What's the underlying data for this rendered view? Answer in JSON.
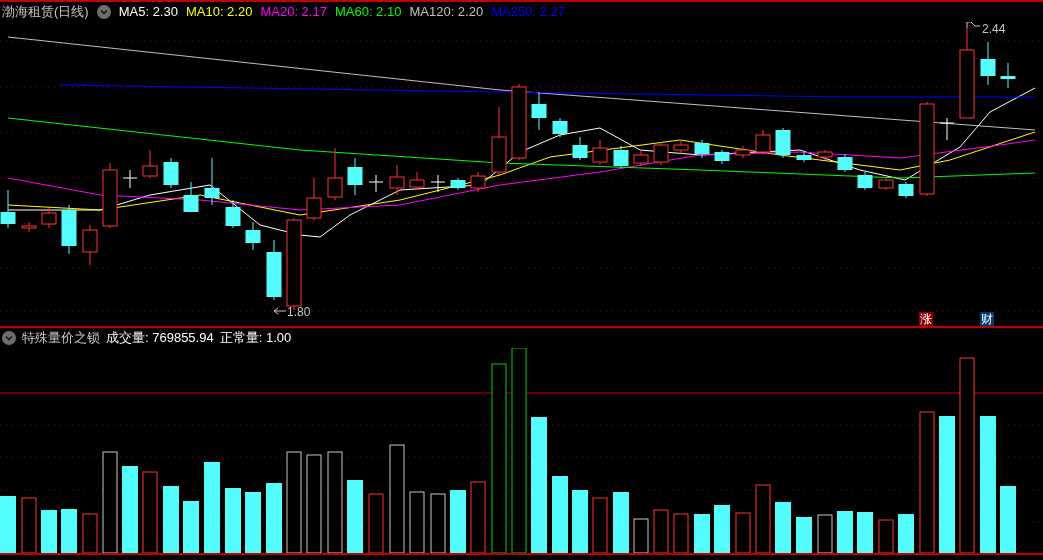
{
  "title": "渤海租赁(日线)",
  "ma": [
    {
      "label": "MA5: 2.30",
      "color": "#ffffff"
    },
    {
      "label": "MA10: 2.20",
      "color": "#ffff00"
    },
    {
      "label": "MA20: 2.17",
      "color": "#ff00ff"
    },
    {
      "label": "MA60: 2.10",
      "color": "#00ff00"
    },
    {
      "label": "MA120: 2.20",
      "color": "#c0c0c0"
    },
    {
      "label": "MA250: 2.27",
      "color": "#0000ff"
    }
  ],
  "price_labels": {
    "high": "2.44",
    "low": "1.80"
  },
  "markers": [
    {
      "text": "涨",
      "color": "#8b0000"
    },
    {
      "text": "财",
      "color": "#003a70"
    }
  ],
  "indicator": {
    "name": "特殊量价之锁",
    "fields": [
      {
        "label": "成交量: 769855.94",
        "color": "#ffffff"
      },
      {
        "label": "正常量: 1.00",
        "color": "#ffffff"
      }
    ]
  }
}
